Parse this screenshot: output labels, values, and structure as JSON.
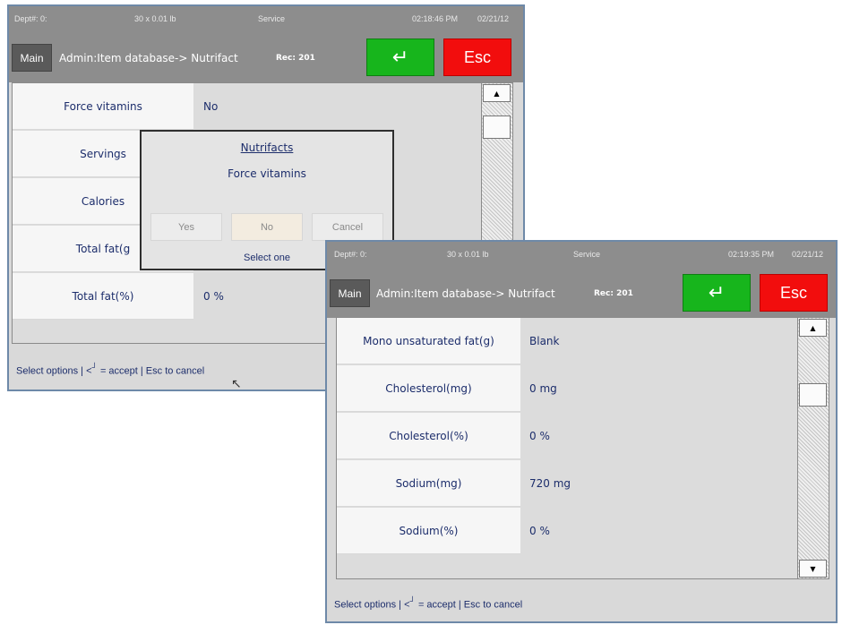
{
  "back_window": {
    "status": {
      "dept": "Dept#: 0:",
      "weight": "30 x 0.01 lb",
      "mode": "Service",
      "time": "02:18:46 PM",
      "date": "02/21/12"
    },
    "main_label": "Main",
    "title": "Admin:Item database-> Nutrifact",
    "rec": "Rec: 201",
    "enter_glyph": "↵",
    "esc_label": "Esc",
    "rows": [
      {
        "label": "Force vitamins",
        "value": "No"
      },
      {
        "label": "Servings",
        "value": ""
      },
      {
        "label": "Calories",
        "value": ""
      },
      {
        "label": "Total fat(g",
        "value": ""
      },
      {
        "label": "Total fat(%)",
        "value": "0 %"
      }
    ],
    "hint": "Select options | <",
    "hint_sup": "┘",
    "hint_rest": " = accept | Esc to cancel",
    "dialog": {
      "title": "Nutrifacts",
      "subtitle": "Force vitamins",
      "yes": "Yes",
      "no": "No",
      "cancel": "Cancel",
      "footer": "Select one"
    }
  },
  "front_window": {
    "status": {
      "dept": "Dept#: 0:",
      "weight": "30 x 0.01 lb",
      "mode": "Service",
      "time": "02:19:35 PM",
      "date": "02/21/12"
    },
    "main_label": "Main",
    "title": "Admin:Item database-> Nutrifact",
    "rec": "Rec: 201",
    "enter_glyph": "↵",
    "esc_label": "Esc",
    "rows": [
      {
        "label": "Mono unsaturated fat(g)",
        "value": "Blank"
      },
      {
        "label": "Cholesterol(mg)",
        "value": "0 mg"
      },
      {
        "label": "Cholesterol(%)",
        "value": "0 %"
      },
      {
        "label": "Sodium(mg)",
        "value": "720 mg"
      },
      {
        "label": "Sodium(%)",
        "value": "0 %"
      }
    ],
    "hint": "Select options | <",
    "hint_sup": "┘",
    "hint_rest": " = accept | Esc to cancel"
  },
  "colors": {
    "enter": "#17b51c",
    "esc": "#f20d0d",
    "text": "#1c2d6b",
    "bar": "#8d8d8d"
  },
  "icons": {
    "enter": "enter-arrow-icon",
    "scroll_up": "triangle-up-icon",
    "scroll_down": "triangle-down-icon",
    "cursor": "mouse-pointer-icon"
  }
}
